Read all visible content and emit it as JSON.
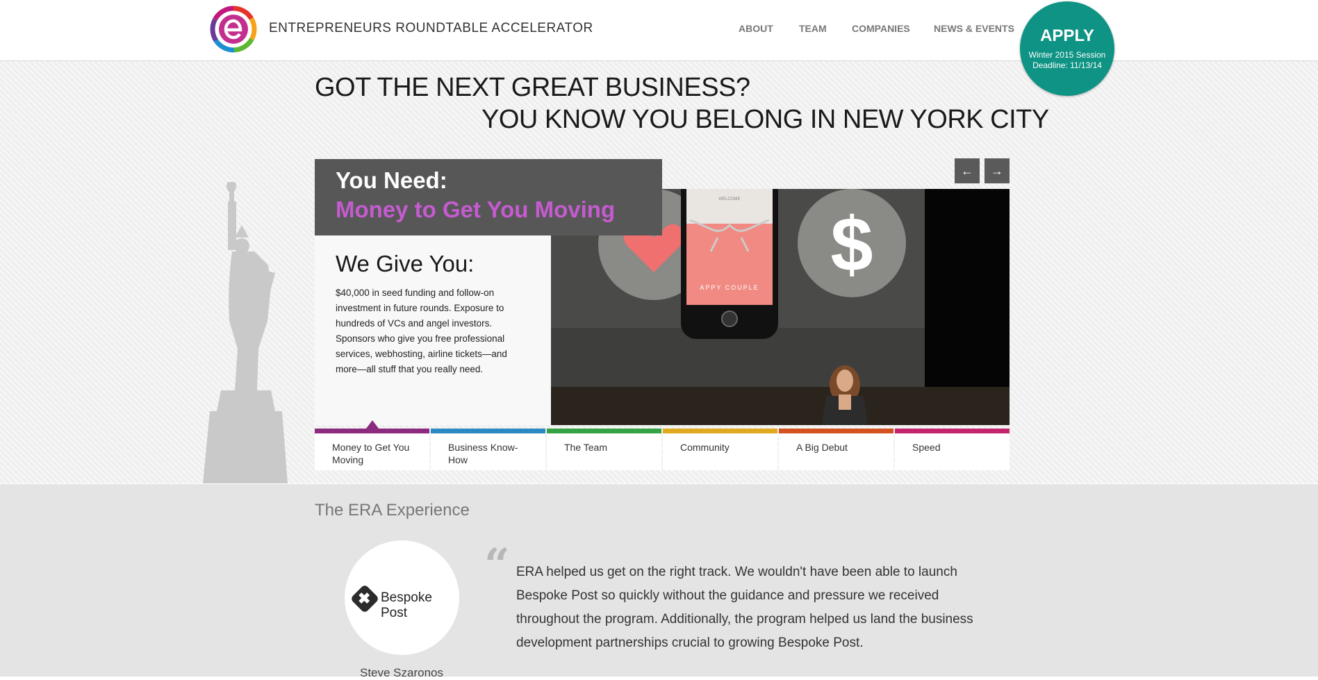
{
  "header": {
    "brand": "ENTREPRENEURS ROUNDTABLE ACCELERATOR",
    "nav": [
      "ABOUT",
      "TEAM",
      "COMPANIES",
      "NEWS & EVENTS"
    ],
    "apply": {
      "label": "APPLY",
      "session": "Winter 2015 Session",
      "deadline": "Deadline: 11/13/14"
    }
  },
  "hero": {
    "headline_1": "GOT THE NEXT GREAT BUSINESS?",
    "headline_2": "YOU KNOW YOU BELONG IN NEW YORK CITY",
    "prev_icon": "arrow-left-icon",
    "next_icon": "arrow-right-icon",
    "need_label": "You Need:",
    "need_value": "Money to Get You Moving",
    "give_title": "We Give You:",
    "give_text": "$40,000 in seed funding and follow-on investment in future rounds. Exposure to hundreds of VCs and angel investors. Sponsors who give you free professional services, webhosting, airline tickets—and more—all stuff that you really need.",
    "phone_welcome": "WELCOME",
    "phone_app": "APPY COUPLE",
    "tabs": [
      {
        "label": "Money to Get You Moving",
        "color": "#8b2a7e"
      },
      {
        "label": "Business Know-How",
        "color": "#2a8ac4"
      },
      {
        "label": "The Team",
        "color": "#35a244"
      },
      {
        "label": "Community",
        "color": "#e0a91f"
      },
      {
        "label": "A Big Debut",
        "color": "#d35220"
      },
      {
        "label": "Speed",
        "color": "#c4256e"
      }
    ]
  },
  "experience": {
    "title": "The ERA Experience",
    "company": "Bespoke Post",
    "quote": "ERA helped us get on the right track. We wouldn't have been able to launch Bespoke Post so quickly without the guidance and pressure we received throughout the program. Additionally, the program helped us land the business development partnerships crucial to growing Bespoke Post.",
    "person": "Steve Szaronos"
  }
}
